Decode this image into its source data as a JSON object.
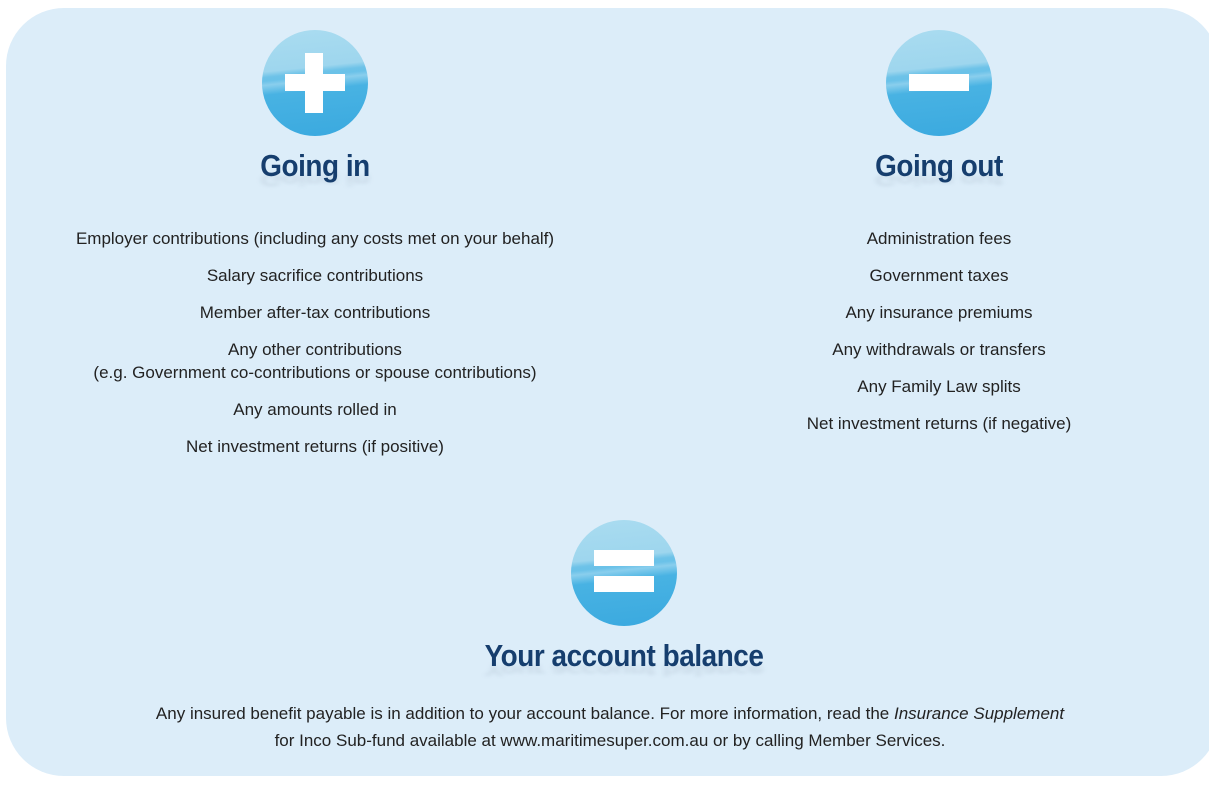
{
  "going_in": {
    "heading": "Going in",
    "items": [
      "Employer contributions (including any costs met on your behalf)",
      "Salary sacrifice contributions",
      "Member after-tax contributions",
      "Any other contributions",
      "(e.g. Government co-contributions or spouse contributions)",
      "Any amounts rolled in",
      "Net investment returns (if positive)"
    ]
  },
  "going_out": {
    "heading": "Going out",
    "items": [
      "Administration fees",
      "Government taxes",
      "Any insurance premiums",
      "Any withdrawals or transfers",
      "Any Family Law splits",
      "Net investment returns (if negative)"
    ]
  },
  "balance": {
    "heading": "Your account balance",
    "note_part1": "Any insured benefit payable is in addition to your account balance. For more information, read the ",
    "note_emphasis": "Insurance Supplement",
    "note_part2": "for Inco Sub-fund available at www.maritimesuper.com.au or by calling Member Services."
  },
  "colors": {
    "panel": "#dcedf9",
    "heading": "#163e6e",
    "icon": "#3aa9df"
  },
  "icons": [
    "plus-icon",
    "minus-icon",
    "equals-icon"
  ]
}
